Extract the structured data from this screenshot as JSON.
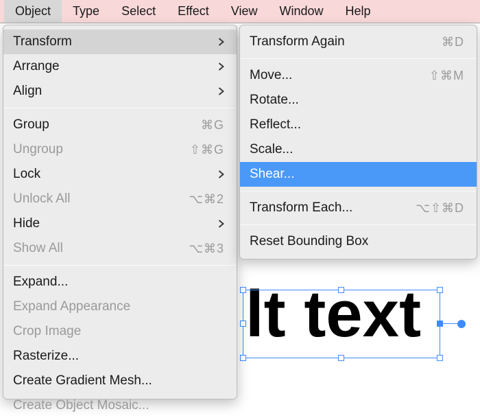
{
  "menubar": {
    "items": [
      {
        "label": "Object",
        "active": true
      },
      {
        "label": "Type"
      },
      {
        "label": "Select"
      },
      {
        "label": "Effect"
      },
      {
        "label": "View"
      },
      {
        "label": "Window"
      },
      {
        "label": "Help"
      }
    ]
  },
  "dropdown": {
    "items": [
      {
        "label": "Transform",
        "arrow": true,
        "active": true
      },
      {
        "label": "Arrange",
        "arrow": true
      },
      {
        "label": "Align",
        "arrow": true
      },
      {
        "sep": true
      },
      {
        "label": "Group",
        "shortcut": "⌘G"
      },
      {
        "label": "Ungroup",
        "shortcut": "⇧⌘G",
        "disabled": true
      },
      {
        "label": "Lock",
        "arrow": true
      },
      {
        "label": "Unlock All",
        "shortcut": "⌥⌘2",
        "disabled": true
      },
      {
        "label": "Hide",
        "arrow": true
      },
      {
        "label": "Show All",
        "shortcut": "⌥⌘3",
        "disabled": true
      },
      {
        "sep": true
      },
      {
        "label": "Expand..."
      },
      {
        "label": "Expand Appearance",
        "disabled": true
      },
      {
        "label": "Crop Image",
        "disabled": true
      },
      {
        "label": "Rasterize..."
      },
      {
        "label": "Create Gradient Mesh..."
      },
      {
        "label": "Create Object Mosaic...",
        "disabled": true
      }
    ]
  },
  "submenu": {
    "items": [
      {
        "label": "Transform Again",
        "shortcut": "⌘D"
      },
      {
        "sep": true
      },
      {
        "label": "Move...",
        "shortcut": "⇧⌘M"
      },
      {
        "label": "Rotate..."
      },
      {
        "label": "Reflect..."
      },
      {
        "label": "Scale..."
      },
      {
        "label": "Shear...",
        "highlight": true
      },
      {
        "sep": true
      },
      {
        "label": "Transform Each...",
        "shortcut": "⌥⇧⌘D"
      },
      {
        "sep": true
      },
      {
        "label": "Reset Bounding Box"
      }
    ]
  },
  "canvas": {
    "text": "lt text"
  }
}
